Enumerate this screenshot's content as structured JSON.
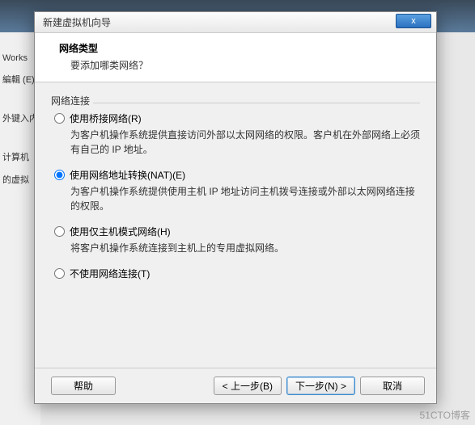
{
  "bg": {
    "works": "Works",
    "edit": "編輯 (E)",
    "keyin": "外键入内",
    "comp": "计算机",
    "vm": "的虚拟"
  },
  "dialog": {
    "title": "新建虚拟机向导",
    "close": "x"
  },
  "header": {
    "title": "网络类型",
    "subtitle": "要添加哪类网络？"
  },
  "group": {
    "label": "网络连接"
  },
  "options": {
    "bridged": {
      "label": "使用桥接网络(R)",
      "accel": "R",
      "desc": "为客户机操作系统提供直接访问外部以太网网络的权限。客户机在外部网络上必须有自己的 IP 地址。"
    },
    "nat": {
      "label": "使用网络地址转换(NAT)(E)",
      "accel": "E",
      "desc": "为客户机操作系统提供使用主机 IP 地址访问主机拨号连接或外部以太网网络连接的权限。"
    },
    "hostonly": {
      "label": "使用仅主机模式网络(H)",
      "accel": "H",
      "desc": "将客户机操作系统连接到主机上的专用虚拟网络。"
    },
    "none": {
      "label": "不使用网络连接(T)",
      "accel": "T"
    }
  },
  "footer": {
    "help": "帮助",
    "back": "< 上一步(B)",
    "next": "下一步(N) >",
    "cancel": "取消"
  },
  "watermark": "51CTO博客"
}
